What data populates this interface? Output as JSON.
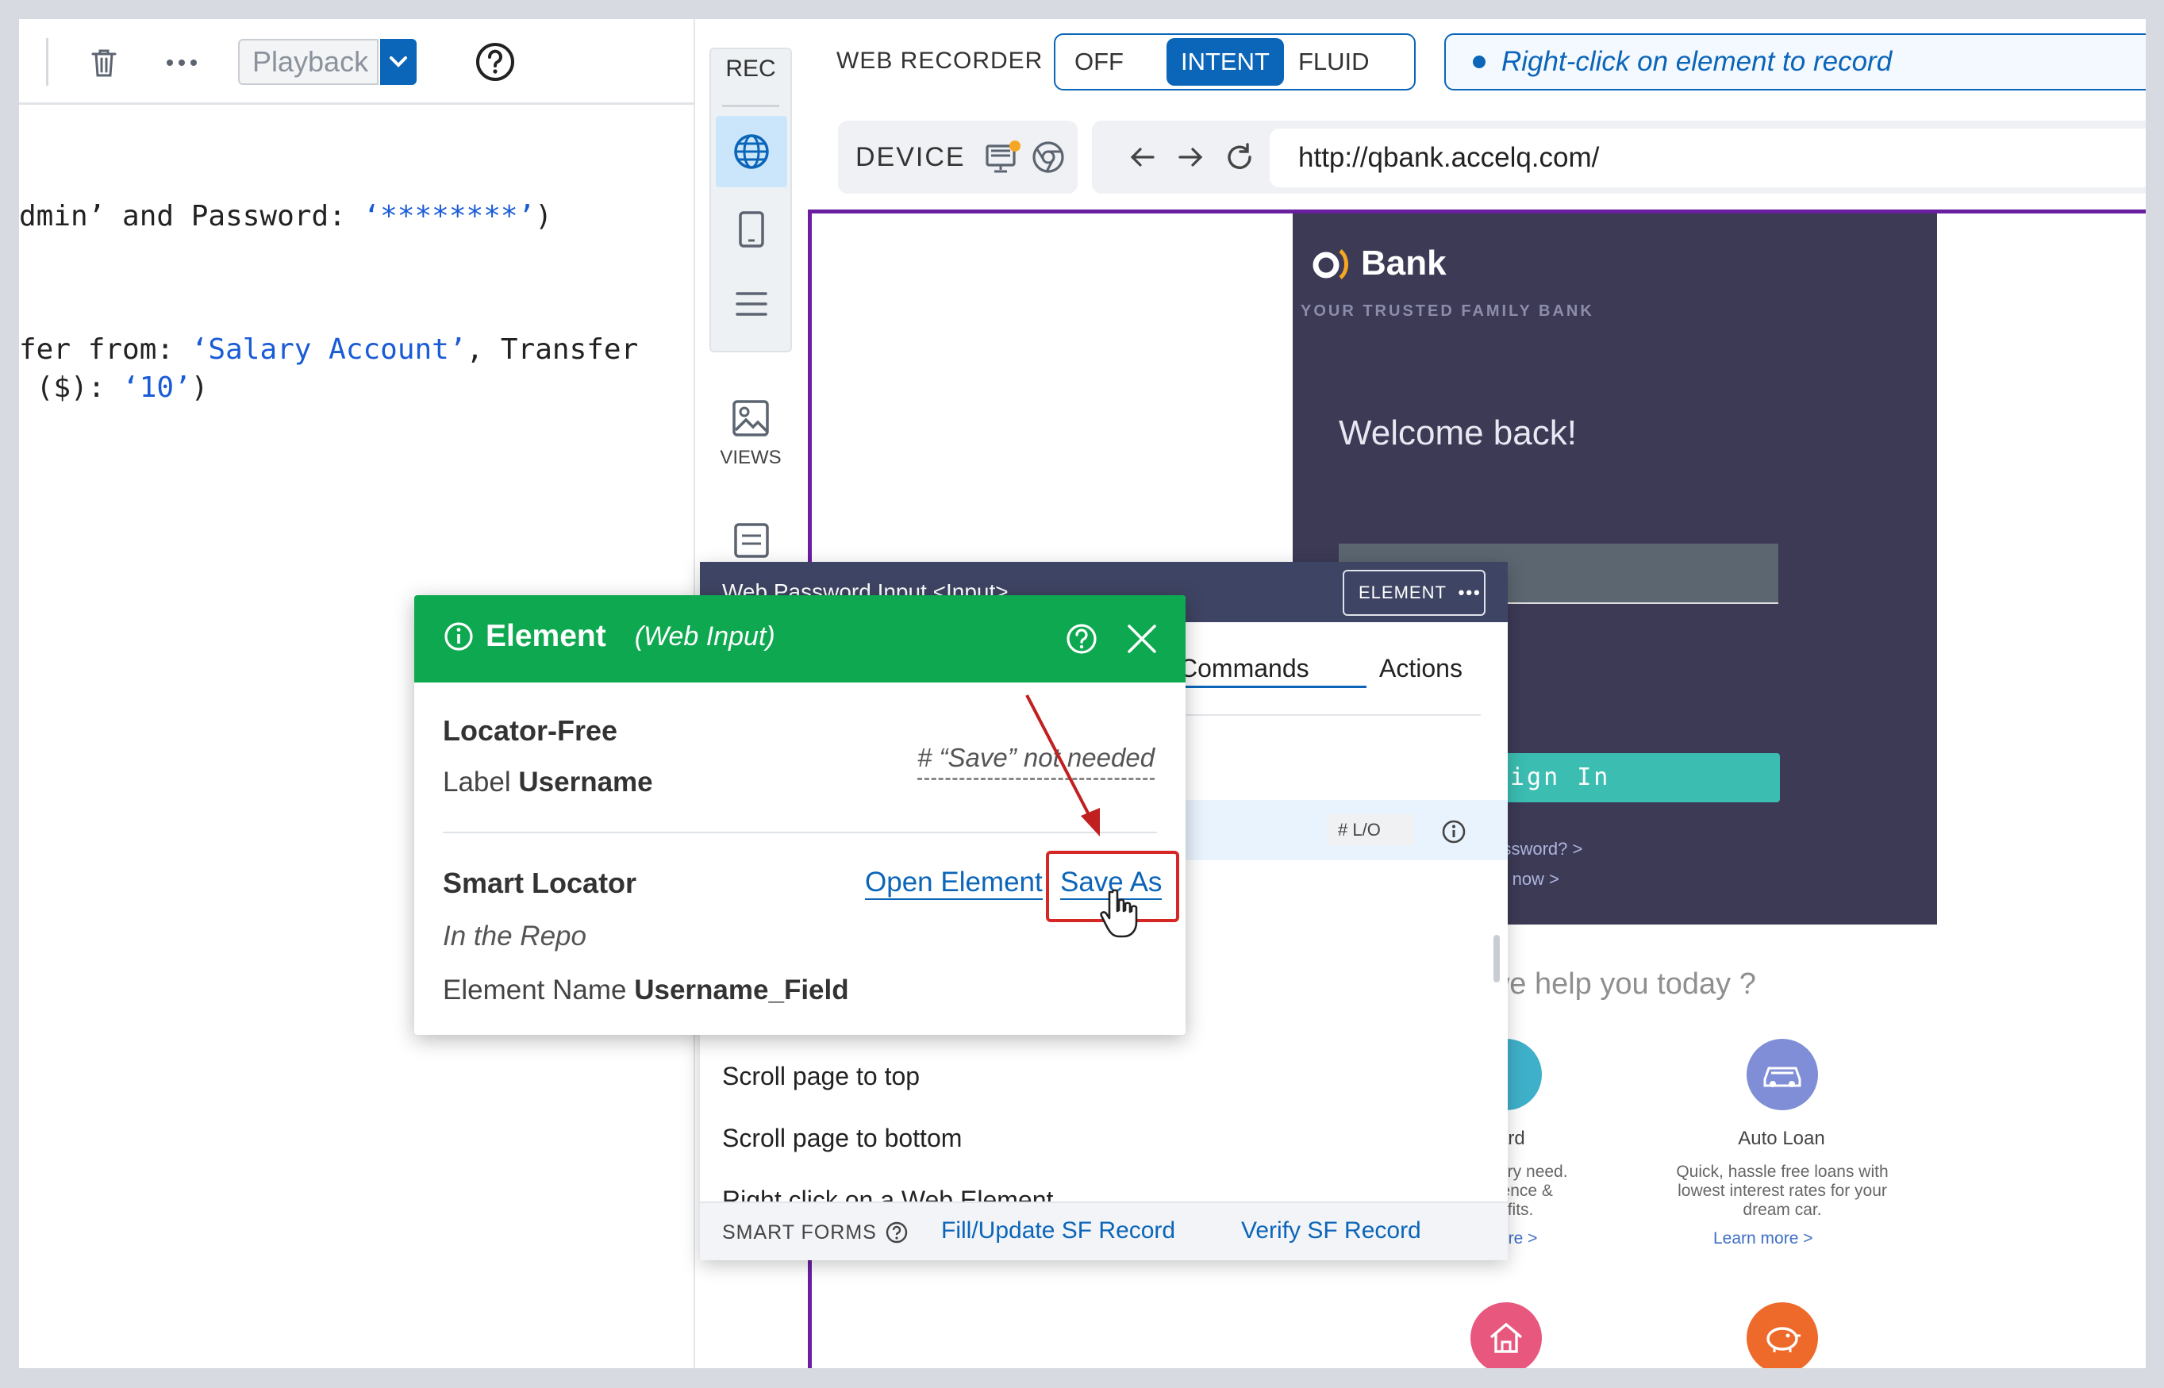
{
  "editor": {
    "toolbar": {
      "playback_label": "Playback"
    },
    "code_lines": [
      {
        "pre": "dmin’ and Password: ",
        "str": "‘********’",
        "post": ")"
      },
      {
        "pre": "fer from: ",
        "str": "‘Salary Account’",
        "post": ", Transfer"
      },
      {
        "pre": " ($): ",
        "str": "‘10’",
        "post": ")"
      }
    ]
  },
  "rail": {
    "rec_label": "REC",
    "views_label": "VIEWS"
  },
  "recorder": {
    "title": "WEB RECORDER",
    "modes": [
      "OFF",
      "INTENT",
      "FLUID"
    ],
    "active_mode": "INTENT",
    "hint": "Right-click on element to record",
    "device_label": "DEVICE",
    "url": "http://qbank.accelq.com/"
  },
  "bank": {
    "brand": "Bank",
    "tagline": "YOUR TRUSTED FAMILY BANK",
    "welcome": "Welcome back!",
    "signin": "ign In",
    "forgot": "password?  >",
    "signup": "up now  >",
    "help_title": "can we help you today ?",
    "services": [
      {
        "title": "ard",
        "desc": [
          "r every need.",
          "venience &",
          "benefits."
        ],
        "link": "ore  >"
      },
      {
        "title": "Auto Loan",
        "desc": [
          "Quick, hassle free loans with",
          "lowest interest rates for your",
          "dream car."
        ],
        "link": "Learn more  >"
      }
    ]
  },
  "commands_panel": {
    "header_title": "Web Password Input  <Input>",
    "element_button": "ELEMENT",
    "tabs": [
      "Commands",
      "Actions"
    ],
    "lo_badge": "L/O",
    "items": [
      "Scroll page to top",
      "Scroll page to bottom",
      "Right click on a Web Element"
    ],
    "footer_label": "SMART FORMS",
    "footer_links": [
      "Fill/Update SF Record",
      "Verify SF Record"
    ]
  },
  "element_popup": {
    "title": "Element",
    "subtitle": "(Web Input)",
    "locator_free_title": "Locator-Free",
    "label_prefix": "Label",
    "label_value": "Username",
    "note": "# “Save” not needed",
    "smart_locator_title": "Smart Locator",
    "repo_text": "In the Repo",
    "element_name_prefix": "Element Name",
    "element_name_value": "Username_Field",
    "open_element": "Open Element",
    "save_as": "Save As"
  },
  "colors": {
    "accent_blue": "#0b65b8",
    "popup_green": "#0da84f",
    "highlight_red": "#d62727",
    "bank_dark": "#3c3a55",
    "viewport_border": "#6a1fa0"
  }
}
